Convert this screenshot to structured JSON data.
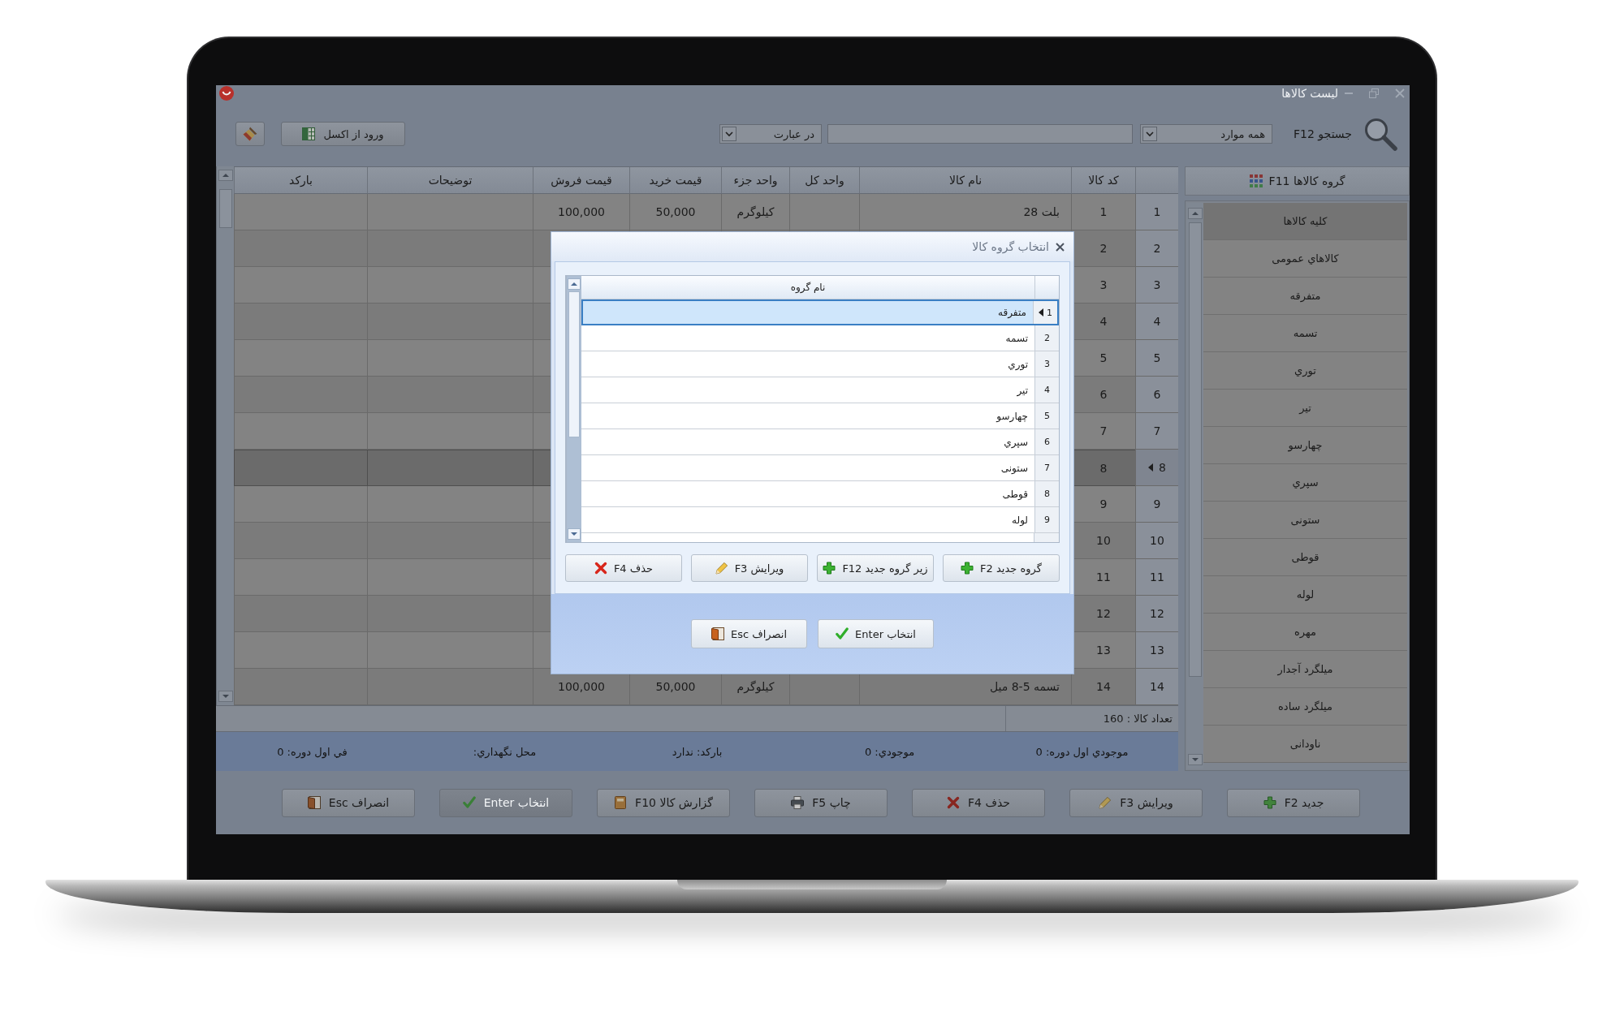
{
  "window": {
    "title": "لیست کالاها"
  },
  "toolbar": {
    "search_label": "جستجو F12",
    "scope": "همه موارد",
    "match": "در عبارت",
    "import_button": "ورود از اکسل"
  },
  "sidebar": {
    "title": "گروه کالاها F11",
    "items": [
      {
        "label": "کلیه کالاها",
        "selected": true
      },
      {
        "label": "کالاهاي عمومی",
        "selected": false
      },
      {
        "label": "متفرقه",
        "selected": false
      },
      {
        "label": "تسمه",
        "selected": false
      },
      {
        "label": "توري",
        "selected": false
      },
      {
        "label": "تیر",
        "selected": false
      },
      {
        "label": "چهارسو",
        "selected": false
      },
      {
        "label": "سپري",
        "selected": false
      },
      {
        "label": "ستونی",
        "selected": false
      },
      {
        "label": "قوطی",
        "selected": false
      },
      {
        "label": "لوله",
        "selected": false
      },
      {
        "label": "مهره",
        "selected": false
      },
      {
        "label": "میلگرد آجدار",
        "selected": false
      },
      {
        "label": "میلگرد ساده",
        "selected": false
      },
      {
        "label": "ناودانی",
        "selected": false
      }
    ]
  },
  "table": {
    "columns": [
      "کد کالا",
      "نام کالا",
      "واحد کل",
      "واحد جزء",
      "قیمت خرید",
      "قیمت فروش",
      "توضیحات",
      "بارکد"
    ],
    "rows": [
      {
        "number": "1",
        "selected": false,
        "code": "1",
        "name": "بلت 28",
        "unit_part": "کیلوگرم",
        "purchase_price": "50,000",
        "sale_price": "100,000"
      },
      {
        "number": "2",
        "selected": false,
        "code": "2"
      },
      {
        "number": "3",
        "selected": false,
        "code": "3"
      },
      {
        "number": "4",
        "selected": false,
        "code": "4"
      },
      {
        "number": "5",
        "selected": false,
        "code": "5"
      },
      {
        "number": "6",
        "selected": false,
        "code": "6"
      },
      {
        "number": "7",
        "selected": false,
        "code": "7"
      },
      {
        "number": "8",
        "selected": true,
        "code": "8"
      },
      {
        "number": "9",
        "selected": false,
        "code": "9"
      },
      {
        "number": "10",
        "selected": false,
        "code": "10"
      },
      {
        "number": "11",
        "selected": false,
        "code": "11"
      },
      {
        "number": "12",
        "selected": false,
        "code": "12"
      },
      {
        "number": "13",
        "selected": false,
        "code": "13"
      },
      {
        "number": "14",
        "selected": false,
        "code": "14",
        "name": "تسمه 5-8 میل",
        "unit_part": "کیلوگرم",
        "purchase_price": "50,000",
        "sale_price": "100,000"
      }
    ],
    "footer": "تعداد کالا : 160"
  },
  "details": [
    "موجودي اول دوره: 0",
    "موجودي: 0",
    "بارکد: ندارد",
    "محل نگهداري:",
    "في اول دوره: 0"
  ],
  "buttons": [
    {
      "label": "جدید F2",
      "kind": "add",
      "disabled": false
    },
    {
      "label": "ویرایش F3",
      "kind": "edit",
      "disabled": false
    },
    {
      "label": "حذف F4",
      "kind": "delete",
      "disabled": false
    },
    {
      "label": "چاپ F5",
      "kind": "print",
      "disabled": false
    },
    {
      "label": "گزارش کالا F10",
      "kind": "report",
      "disabled": false
    },
    {
      "label": "انتخاب Enter",
      "kind": "select",
      "disabled": true
    },
    {
      "label": "انصراف Esc",
      "kind": "cancel",
      "disabled": false
    }
  ],
  "dialog": {
    "title": "انتخاب گروه کالا",
    "column": "نام گروه",
    "rows": [
      {
        "number": "1",
        "name": "متفرقه",
        "selected": true
      },
      {
        "number": "2",
        "name": "تسمه",
        "selected": false
      },
      {
        "number": "3",
        "name": "توري",
        "selected": false
      },
      {
        "number": "4",
        "name": "تیر",
        "selected": false
      },
      {
        "number": "5",
        "name": "چهارسو",
        "selected": false
      },
      {
        "number": "6",
        "name": "سپري",
        "selected": false
      },
      {
        "number": "7",
        "name": "ستونی",
        "selected": false
      },
      {
        "number": "8",
        "name": "قوطی",
        "selected": false
      },
      {
        "number": "9",
        "name": "لوله",
        "selected": false
      }
    ],
    "buttons": [
      {
        "label": "گروه جدید F2",
        "kind": "add"
      },
      {
        "label": "زیر گروه جدید F12",
        "kind": "subgroup"
      },
      {
        "label": "ویرایش F3",
        "kind": "edit"
      },
      {
        "label": "حذف F4",
        "kind": "delete"
      }
    ],
    "footer_buttons": [
      {
        "label": "انتخاب Enter",
        "kind": "select"
      },
      {
        "label": "انصراف Esc",
        "kind": "cancel"
      }
    ]
  }
}
